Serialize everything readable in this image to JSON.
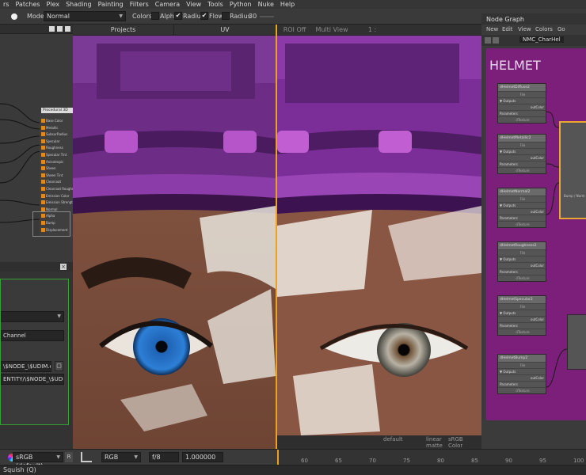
{
  "menubar": {
    "items": [
      "rs",
      "Patches",
      "Plex",
      "Shading",
      "Painting",
      "Filters",
      "Camera",
      "View",
      "Tools",
      "Python",
      "Nuke",
      "Help"
    ]
  },
  "toolbar": {
    "mode_label": "Mode",
    "mode_value": "Normal",
    "colors_label": "Colors",
    "alpha_label": "Alpha",
    "alpha_checked": false,
    "radius_label": "Radius",
    "radius_checked": true,
    "flow_label": "Flow",
    "flow_checked": true,
    "radius2_label": "Radius",
    "radius2_checked": false,
    "radius2_value": "30"
  },
  "shader_graph": {
    "preview_label": "Procedural 3D",
    "pins": [
      "Base Color",
      "Metallic",
      "SubsurRadius",
      "Specular",
      "Roughness",
      "Specular Tint",
      "Anisotropic",
      "Sheen",
      "Sheen Tint",
      "Clearcoat",
      "Clearcoat Roughness",
      "Emission Color",
      "Emission Strength",
      "Normal",
      "Alpha",
      "Bump",
      "Displacement"
    ]
  },
  "properties": {
    "channel_label": "Channel",
    "path1": "\\$NODE_\\$UDIM.exr",
    "path2": "ENTITY/\\$NODE_\\$UDIM.tdl"
  },
  "viewport_left": {
    "tabs": [
      "Projects",
      "UV"
    ]
  },
  "viewport_right": {
    "toolbar": [
      "ROI Off",
      "Multi View Off",
      "1 : 256.00"
    ],
    "breadcrumb": "NMC_CharHel",
    "footer": [
      "default",
      "linear",
      "sRGB",
      "matte",
      "Color"
    ]
  },
  "node_graph": {
    "title": "Node Graph",
    "menu": [
      "New",
      "Edit",
      "View",
      "Colors",
      "Go"
    ],
    "heading": "HELMET",
    "nodes": [
      {
        "name": "dHelmetDiffuse2",
        "type": "File",
        "out": "outColor",
        "param": "Parameters",
        "foot": "dTexture"
      },
      {
        "name": "dHelmetMetallic2",
        "type": "File",
        "out": "outColor",
        "param": "Parameters",
        "foot": "dTexture"
      },
      {
        "name": "dHelmetNormal2",
        "type": "File",
        "out": "outColor",
        "param": "Parameters",
        "foot": "dTexture"
      },
      {
        "name": "dHelmetRoughness2",
        "type": "File",
        "out": "outColor",
        "param": "Parameters",
        "foot": "dTexture"
      },
      {
        "name": "dHelmetSpecular2",
        "type": "File",
        "out": "outColor",
        "param": "Parameters",
        "foot": "dTexture"
      },
      {
        "name": "dHelmetBump2",
        "type": "File",
        "out": "outColor",
        "param": "Parameters",
        "foot": "dTexture"
      }
    ],
    "bump_label": "Bump / Norm"
  },
  "bottom": {
    "colorspace": "sRGB (default)",
    "channels": "RGB",
    "fstop": "f/8",
    "gain": "1.000000",
    "timeline_ticks": [
      "60",
      "65",
      "70",
      "75",
      "80",
      "85",
      "90",
      "95",
      "100"
    ]
  },
  "status": {
    "text": "Squish (Q)"
  },
  "colors": {
    "accent": "#f0a020",
    "node_bg": "#7c1f7a",
    "panel": "#3a3a3a"
  }
}
